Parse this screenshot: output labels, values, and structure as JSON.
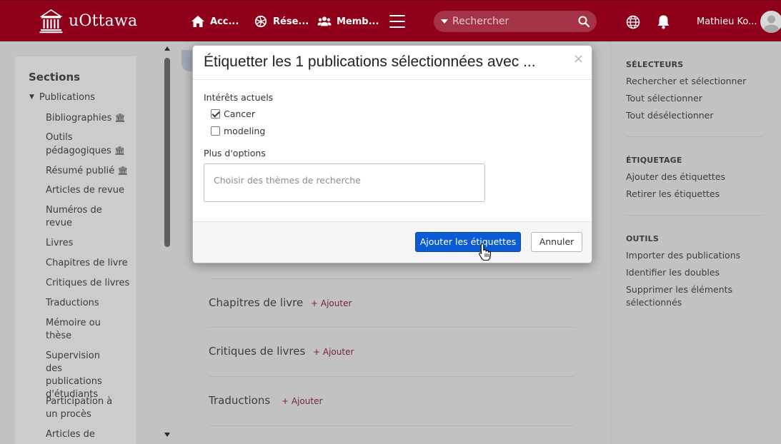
{
  "header": {
    "logo_text": "uOttawa",
    "nav": [
      {
        "label": "Acc...",
        "icon": "home-icon"
      },
      {
        "label": "Rése...",
        "icon": "network-icon"
      },
      {
        "label": "Memb...",
        "icon": "members-icon"
      }
    ],
    "search_placeholder": "Rechercher",
    "user_name": "Mathieu Ko..."
  },
  "colors": {
    "brand": "#8f001a",
    "primary_button": "#0a5bd4",
    "add_link": "#7a2436"
  },
  "sidebar": {
    "title": "Sections",
    "root": "Publications",
    "items": [
      {
        "label": "Bibliographies",
        "bank": "🏛"
      },
      {
        "label": "Outils pédagogiques",
        "bank": "🏛"
      },
      {
        "label": "Résumé publié",
        "bank": "🏛"
      },
      {
        "label": "Articles de revue"
      },
      {
        "label": "Numéros de revue"
      },
      {
        "label": "Livres"
      },
      {
        "label": "Chapitres de livre"
      },
      {
        "label": "Critiques de livres"
      },
      {
        "label": "Traductions"
      },
      {
        "label": "Mémoire ou thèse"
      },
      {
        "label": "Supervision des publications d'étudiants"
      },
      {
        "label": "Participation à un procès"
      },
      {
        "label": "Articles de"
      }
    ]
  },
  "content": {
    "rows": [
      {
        "title": "Chapitres de livre",
        "add": "+ Ajouter"
      },
      {
        "title": "Critiques de livres",
        "add": "+ Ajouter"
      },
      {
        "title": "Traductions",
        "add": "+ Ajouter"
      }
    ]
  },
  "right_panel": {
    "groups": [
      {
        "heading": "SÉLECTEURS",
        "items": [
          "Rechercher et sélectionner",
          "Tout sélectionner",
          "Tout désélectionner"
        ]
      },
      {
        "heading": "ÉTIQUETAGE",
        "items": [
          "Ajouter des étiquettes",
          "Retirer les étiquettes"
        ]
      },
      {
        "heading": "OUTILS",
        "items": [
          "Importer des publications",
          "Identifier les doubles",
          "Supprimer les éléments sélectionnés"
        ]
      }
    ]
  },
  "modal": {
    "title": "Étiquetter les 1 publications sélectionnées avec ...",
    "close": "×",
    "current_label": "Intérêts actuels",
    "interests": [
      {
        "label": "Cancer",
        "checked": true
      },
      {
        "label": "modeling",
        "checked": false
      }
    ],
    "more_label": "Plus d'options",
    "themes_placeholder": "Choisir des thèmes de recherche",
    "primary_button": "Ajouter les étiquettes",
    "cancel_button": "Annuler"
  }
}
